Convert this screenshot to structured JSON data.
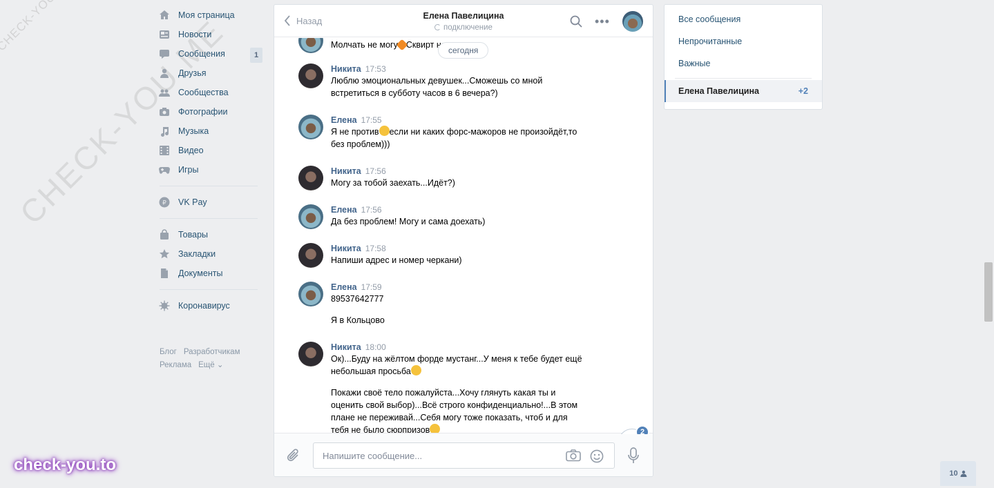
{
  "nav": {
    "items": [
      {
        "label": "Моя страница",
        "icon": "home-icon"
      },
      {
        "label": "Новости",
        "icon": "news-icon"
      },
      {
        "label": "Сообщения",
        "icon": "messages-icon",
        "count": "1"
      },
      {
        "label": "Друзья",
        "icon": "friends-icon"
      },
      {
        "label": "Сообщества",
        "icon": "communities-icon"
      },
      {
        "label": "Фотографии",
        "icon": "photo-icon"
      },
      {
        "label": "Музыка",
        "icon": "music-icon"
      },
      {
        "label": "Видео",
        "icon": "video-icon"
      },
      {
        "label": "Игры",
        "icon": "games-icon"
      }
    ],
    "vkpay": {
      "label": "VK Pay",
      "icon": "vkpay-icon"
    },
    "items2": [
      {
        "label": "Товары",
        "icon": "bag-icon"
      },
      {
        "label": "Закладки",
        "icon": "star-icon"
      },
      {
        "label": "Документы",
        "icon": "document-icon"
      }
    ],
    "corona": {
      "label": "Коронавирус",
      "icon": "virus-icon"
    },
    "footer": [
      "Блог",
      "Разработчикам",
      "Реклама",
      "Ещё ⌄"
    ]
  },
  "chat": {
    "back_label": "Назад",
    "peer_name": "Елена Павелицина",
    "peer_status": "подключение",
    "date_pill": "сегодня",
    "partial_message": "Молчать не могу",
    "partial_message_tail": "Сквирт нол",
    "messages": [
      {
        "author": "Никита",
        "time": "17:53",
        "side": "n",
        "texts": [
          "Люблю эмоциональных девушек...Сможешь со мной\nвстретиться в субботу часов в 6 вечера?)"
        ]
      },
      {
        "author": "Елена",
        "time": "17:55",
        "side": "e",
        "texts": [
          "Я не против",
          "если ни каких форс-мажоров не произойдёт,то\nбез проблем)))"
        ]
      },
      {
        "author": "Никита",
        "time": "17:56",
        "side": "n",
        "texts": [
          "Могу за тобой заехать...Идёт?)"
        ]
      },
      {
        "author": "Елена",
        "time": "17:56",
        "side": "e",
        "texts": [
          "Да без проблем! Могу и сама доехать)"
        ]
      },
      {
        "author": "Никита",
        "time": "17:58",
        "side": "n",
        "texts": [
          "Напиши адрес и номер черкани)"
        ]
      },
      {
        "author": "Елена",
        "time": "17:59",
        "side": "e",
        "texts": [
          "89537642777",
          "Я в Кольцово"
        ]
      },
      {
        "author": "Никита",
        "time": "18:00",
        "side": "n",
        "texts": [
          "Ок)...Буду на жёлтом форде мустанг...У меня к тебе будет ещё\nнебольшая просьба",
          "Покажи своё тело пожалуйста...Хочу глянуть какая ты и\nоценить свой выбор)...Всё строго конфиденциально!...В этом\nплане не переживай...Себя могу тоже показать, чтоб и для\nтебя не было сюрпризов"
        ]
      }
    ],
    "unread_badge": "2",
    "input_placeholder": "Напишите сообщение..."
  },
  "right_panel": {
    "filters": [
      "Все сообщения",
      "Непрочитанные",
      "Важные"
    ],
    "conversation": {
      "name": "Елена Павелицина",
      "count": "+2"
    }
  },
  "online_count": "10",
  "watermarks": {
    "small": "CHECK-YOU.ME",
    "big": "CHECK-YOU.ME",
    "logo": "check-you.to"
  },
  "colors": {
    "link": "#285473",
    "accent": "#5181b8",
    "author": "#42648b",
    "background": "#edeef0"
  }
}
